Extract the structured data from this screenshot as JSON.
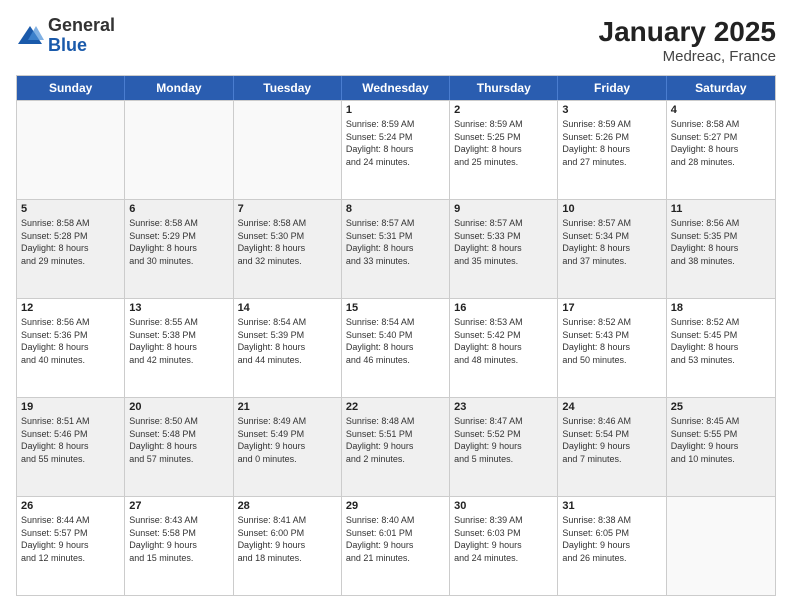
{
  "logo": {
    "general": "General",
    "blue": "Blue"
  },
  "title": "January 2025",
  "subtitle": "Medreac, France",
  "days": [
    "Sunday",
    "Monday",
    "Tuesday",
    "Wednesday",
    "Thursday",
    "Friday",
    "Saturday"
  ],
  "rows": [
    [
      {
        "day": "",
        "info": ""
      },
      {
        "day": "",
        "info": ""
      },
      {
        "day": "",
        "info": ""
      },
      {
        "day": "1",
        "info": "Sunrise: 8:59 AM\nSunset: 5:24 PM\nDaylight: 8 hours\nand 24 minutes."
      },
      {
        "day": "2",
        "info": "Sunrise: 8:59 AM\nSunset: 5:25 PM\nDaylight: 8 hours\nand 25 minutes."
      },
      {
        "day": "3",
        "info": "Sunrise: 8:59 AM\nSunset: 5:26 PM\nDaylight: 8 hours\nand 27 minutes."
      },
      {
        "day": "4",
        "info": "Sunrise: 8:58 AM\nSunset: 5:27 PM\nDaylight: 8 hours\nand 28 minutes."
      }
    ],
    [
      {
        "day": "5",
        "info": "Sunrise: 8:58 AM\nSunset: 5:28 PM\nDaylight: 8 hours\nand 29 minutes."
      },
      {
        "day": "6",
        "info": "Sunrise: 8:58 AM\nSunset: 5:29 PM\nDaylight: 8 hours\nand 30 minutes."
      },
      {
        "day": "7",
        "info": "Sunrise: 8:58 AM\nSunset: 5:30 PM\nDaylight: 8 hours\nand 32 minutes."
      },
      {
        "day": "8",
        "info": "Sunrise: 8:57 AM\nSunset: 5:31 PM\nDaylight: 8 hours\nand 33 minutes."
      },
      {
        "day": "9",
        "info": "Sunrise: 8:57 AM\nSunset: 5:33 PM\nDaylight: 8 hours\nand 35 minutes."
      },
      {
        "day": "10",
        "info": "Sunrise: 8:57 AM\nSunset: 5:34 PM\nDaylight: 8 hours\nand 37 minutes."
      },
      {
        "day": "11",
        "info": "Sunrise: 8:56 AM\nSunset: 5:35 PM\nDaylight: 8 hours\nand 38 minutes."
      }
    ],
    [
      {
        "day": "12",
        "info": "Sunrise: 8:56 AM\nSunset: 5:36 PM\nDaylight: 8 hours\nand 40 minutes."
      },
      {
        "day": "13",
        "info": "Sunrise: 8:55 AM\nSunset: 5:38 PM\nDaylight: 8 hours\nand 42 minutes."
      },
      {
        "day": "14",
        "info": "Sunrise: 8:54 AM\nSunset: 5:39 PM\nDaylight: 8 hours\nand 44 minutes."
      },
      {
        "day": "15",
        "info": "Sunrise: 8:54 AM\nSunset: 5:40 PM\nDaylight: 8 hours\nand 46 minutes."
      },
      {
        "day": "16",
        "info": "Sunrise: 8:53 AM\nSunset: 5:42 PM\nDaylight: 8 hours\nand 48 minutes."
      },
      {
        "day": "17",
        "info": "Sunrise: 8:52 AM\nSunset: 5:43 PM\nDaylight: 8 hours\nand 50 minutes."
      },
      {
        "day": "18",
        "info": "Sunrise: 8:52 AM\nSunset: 5:45 PM\nDaylight: 8 hours\nand 53 minutes."
      }
    ],
    [
      {
        "day": "19",
        "info": "Sunrise: 8:51 AM\nSunset: 5:46 PM\nDaylight: 8 hours\nand 55 minutes."
      },
      {
        "day": "20",
        "info": "Sunrise: 8:50 AM\nSunset: 5:48 PM\nDaylight: 8 hours\nand 57 minutes."
      },
      {
        "day": "21",
        "info": "Sunrise: 8:49 AM\nSunset: 5:49 PM\nDaylight: 9 hours\nand 0 minutes."
      },
      {
        "day": "22",
        "info": "Sunrise: 8:48 AM\nSunset: 5:51 PM\nDaylight: 9 hours\nand 2 minutes."
      },
      {
        "day": "23",
        "info": "Sunrise: 8:47 AM\nSunset: 5:52 PM\nDaylight: 9 hours\nand 5 minutes."
      },
      {
        "day": "24",
        "info": "Sunrise: 8:46 AM\nSunset: 5:54 PM\nDaylight: 9 hours\nand 7 minutes."
      },
      {
        "day": "25",
        "info": "Sunrise: 8:45 AM\nSunset: 5:55 PM\nDaylight: 9 hours\nand 10 minutes."
      }
    ],
    [
      {
        "day": "26",
        "info": "Sunrise: 8:44 AM\nSunset: 5:57 PM\nDaylight: 9 hours\nand 12 minutes."
      },
      {
        "day": "27",
        "info": "Sunrise: 8:43 AM\nSunset: 5:58 PM\nDaylight: 9 hours\nand 15 minutes."
      },
      {
        "day": "28",
        "info": "Sunrise: 8:41 AM\nSunset: 6:00 PM\nDaylight: 9 hours\nand 18 minutes."
      },
      {
        "day": "29",
        "info": "Sunrise: 8:40 AM\nSunset: 6:01 PM\nDaylight: 9 hours\nand 21 minutes."
      },
      {
        "day": "30",
        "info": "Sunrise: 8:39 AM\nSunset: 6:03 PM\nDaylight: 9 hours\nand 24 minutes."
      },
      {
        "day": "31",
        "info": "Sunrise: 8:38 AM\nSunset: 6:05 PM\nDaylight: 9 hours\nand 26 minutes."
      },
      {
        "day": "",
        "info": ""
      }
    ]
  ]
}
